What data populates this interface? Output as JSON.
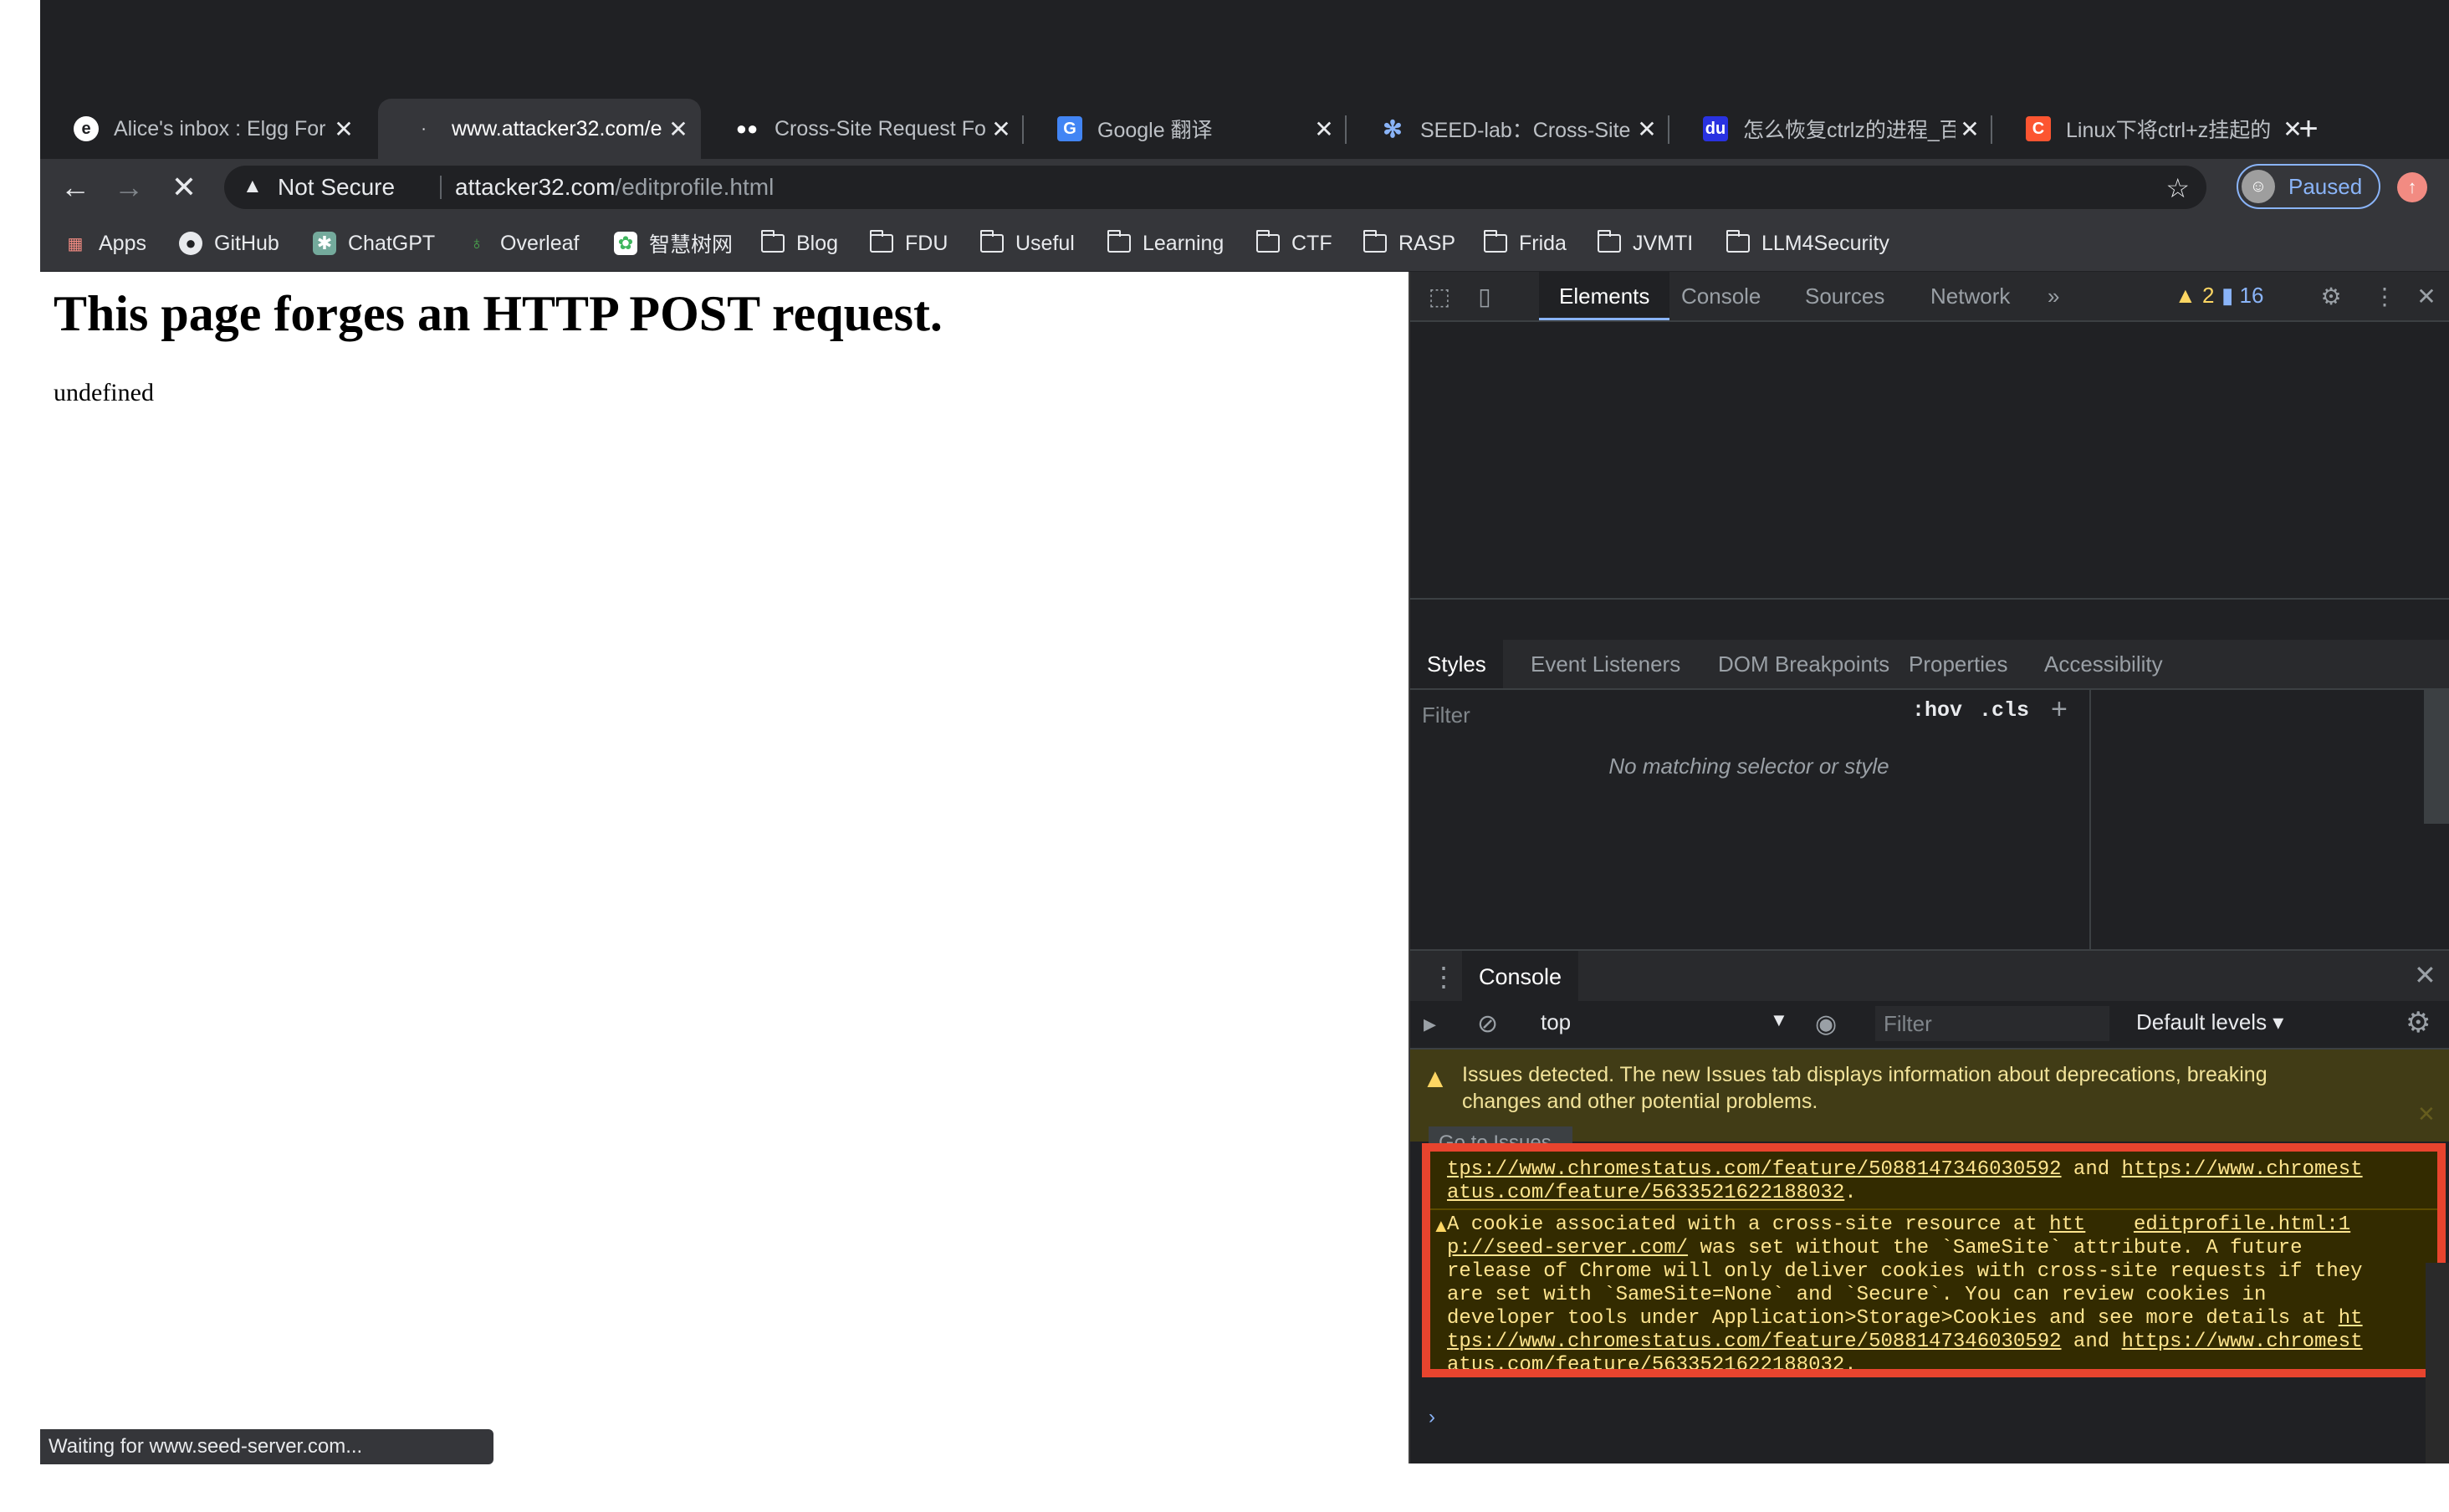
{
  "browser": {
    "tabs": [
      {
        "title": "Alice's inbox : Elgg For",
        "icon": "elgg-icon"
      },
      {
        "title": "www.attacker32.com/e",
        "icon": "loading-icon"
      },
      {
        "title": "Cross-Site Request Fo",
        "icon": "medium-icon"
      },
      {
        "title": "Google 翻译",
        "icon": "google-translate-icon"
      },
      {
        "title": "SEED-lab：Cross-Site",
        "icon": "seed-icon"
      },
      {
        "title": "怎么恢复ctrlz的进程_百",
        "icon": "baidu-icon"
      },
      {
        "title": "Linux下将ctrl+z挂起的",
        "icon": "csdn-icon"
      }
    ],
    "new_tab": "+",
    "security_label": "Not Secure",
    "url_host": "attacker32.com",
    "url_path": "/editprofile.html",
    "profile_label": "Paused",
    "bookmarks": [
      {
        "label": "Apps",
        "icon": "apps-grid-icon"
      },
      {
        "label": "GitHub",
        "icon": "github-icon"
      },
      {
        "label": "ChatGPT",
        "icon": "chatgpt-icon"
      },
      {
        "label": "Overleaf",
        "icon": "overleaf-icon"
      },
      {
        "label": "智慧树网",
        "icon": "zhihuishu-icon"
      },
      {
        "label": "Blog",
        "icon": "folder-icon"
      },
      {
        "label": "FDU",
        "icon": "folder-icon"
      },
      {
        "label": "Useful",
        "icon": "folder-icon"
      },
      {
        "label": "Learning",
        "icon": "folder-icon"
      },
      {
        "label": "CTF",
        "icon": "folder-icon"
      },
      {
        "label": "RASP",
        "icon": "folder-icon"
      },
      {
        "label": "Frida",
        "icon": "folder-icon"
      },
      {
        "label": "JVMTI",
        "icon": "folder-icon"
      },
      {
        "label": "LLM4Security",
        "icon": "folder-icon"
      }
    ],
    "status_text": "Waiting for www.seed-server.com..."
  },
  "page": {
    "heading": "This page forges an HTTP POST request.",
    "text": "undefined"
  },
  "devtools": {
    "main_tabs": [
      "Elements",
      "Console",
      "Sources",
      "Network"
    ],
    "more_tabs": "»",
    "warnings_count": "2",
    "messages_count": "16",
    "styles_tabs": [
      "Styles",
      "Event Listeners",
      "DOM Breakpoints",
      "Properties",
      "Accessibility"
    ],
    "styles_filter_placeholder": "Filter",
    "hov": ":hov",
    "cls": ".cls",
    "no_match": "No matching selector or style",
    "drawer_tab": "Console",
    "context": "top",
    "console_filter_placeholder": "Filter",
    "levels": "Default levels",
    "issues_banner": "Issues detected. The new Issues tab displays information about deprecations, breaking changes and other potential problems.",
    "goto_issues": "Go to Issues",
    "log1": {
      "l1a": "tps://www.chromestatus.com/feature/5088147346030592",
      "and": " and ",
      "l1b": "https://www.chromest",
      "l2": "atus.com/feature/5633521622188032",
      "dot": "."
    },
    "log2": {
      "intro": "A cookie associated with a cross-site resource at ",
      "link_a": "htt",
      "source": "editprofile.html:1",
      "link_b": "p://seed-server.com/",
      "t1": " was set without the `SameSite` attribute. A future",
      "t2": "release of Chrome will only deliver cookies with cross-site requests if they",
      "t3": "are set with `SameSite=None` and `Secure`. You can review cookies in",
      "t4": "developer tools under Application>Storage>Cookies and see more details at ",
      "t4link": "ht",
      "t5a": "tps://www.chromestatus.com/feature/5088147346030592",
      "and": " and ",
      "t5b": "https://www.chromest",
      "t6": "atus.com/feature/5633521622188032",
      "dot": "."
    },
    "prompt": "›"
  }
}
